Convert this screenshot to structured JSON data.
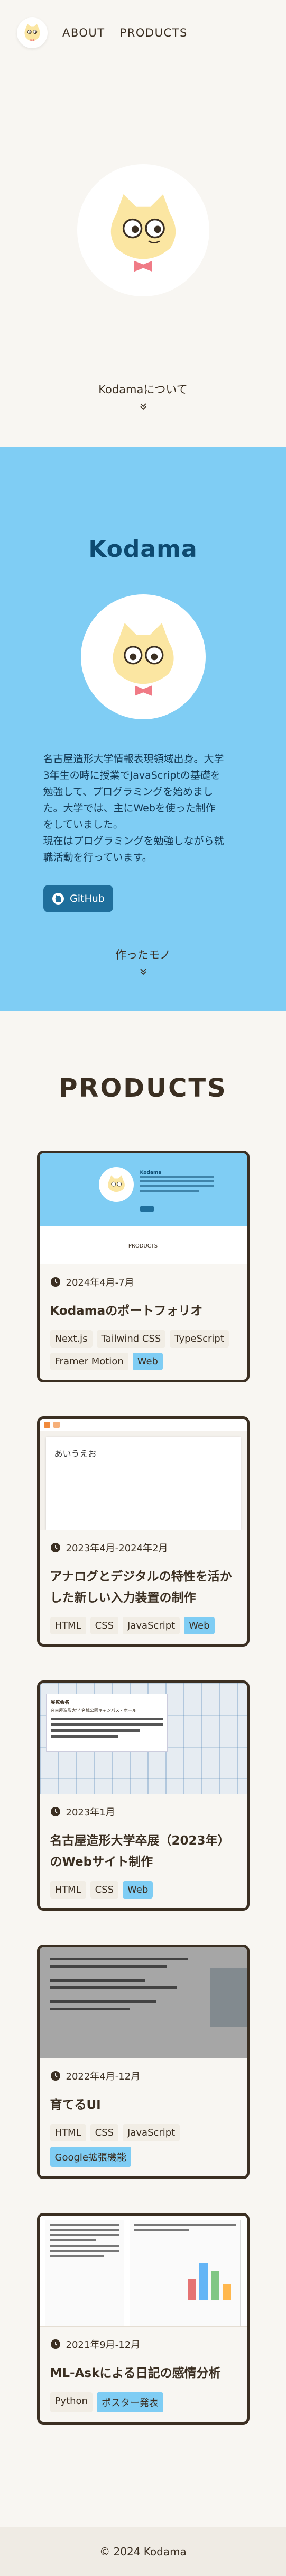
{
  "header": {
    "nav": [
      {
        "label": "ABOUT"
      },
      {
        "label": "PRODUCTS"
      }
    ]
  },
  "hero": {
    "scroll_label": "Kodamaについて"
  },
  "about": {
    "title": "Kodama",
    "text": "名古屋造形大学情報表現領域出身。大学\n3年生の時に授業でJavaScriptの基礎を\n勉強して、プログラミングを始めまし\nた。大学では、主にWebを使った制作\nをしていました。\n現在はプログラミングを勉強しながら就\n職活動を行っています。",
    "github_label": "GitHub",
    "scroll_label": "作ったモノ"
  },
  "products": {
    "title": "PRODUCTS",
    "items": [
      {
        "date": "2024年4月-7月",
        "title": "Kodamaのポートフォリオ",
        "tags": [
          "Next.js",
          "Tailwind CSS",
          "TypeScript",
          "Framer Motion",
          "Web"
        ],
        "highlight": [
          "Web"
        ]
      },
      {
        "date": "2023年4月-2024年2月",
        "title": "アナログとデジタルの特性を活かした新しい入力装置の制作",
        "tags": [
          "HTML",
          "CSS",
          "JavaScript",
          "Web"
        ],
        "highlight": [
          "Web"
        ]
      },
      {
        "date": "2023年1月",
        "title": "名古屋造形大学卒展（2023年）のWebサイト制作",
        "tags": [
          "HTML",
          "CSS",
          "Web"
        ],
        "highlight": [
          "Web"
        ]
      },
      {
        "date": "2022年4月-12月",
        "title": "育てるUI",
        "tags": [
          "HTML",
          "CSS",
          "JavaScript",
          "Google拡張機能"
        ],
        "highlight": [
          "Google拡張機能"
        ]
      },
      {
        "date": "2021年9月-12月",
        "title": "ML-Askによる日記の感情分析",
        "tags": [
          "Python",
          "ポスター発表"
        ],
        "highlight": [
          "ポスター発表"
        ]
      }
    ],
    "thumb_texts": {
      "t1_brand": "Kodama",
      "t1_products": "PRODUCTS",
      "t2_input": "あいうえお",
      "t3_heading": "展覧会名",
      "t3_sub": "名古屋造形大学 名城公園キャンパス・ホール"
    }
  },
  "footer": {
    "copyright": "© 2024 Kodama"
  },
  "colors": {
    "accent_blue": "#7fcdf4",
    "title_navy": "#0d4a70",
    "text_brown": "#3b2f22",
    "github_bg": "#1f6f9c"
  }
}
